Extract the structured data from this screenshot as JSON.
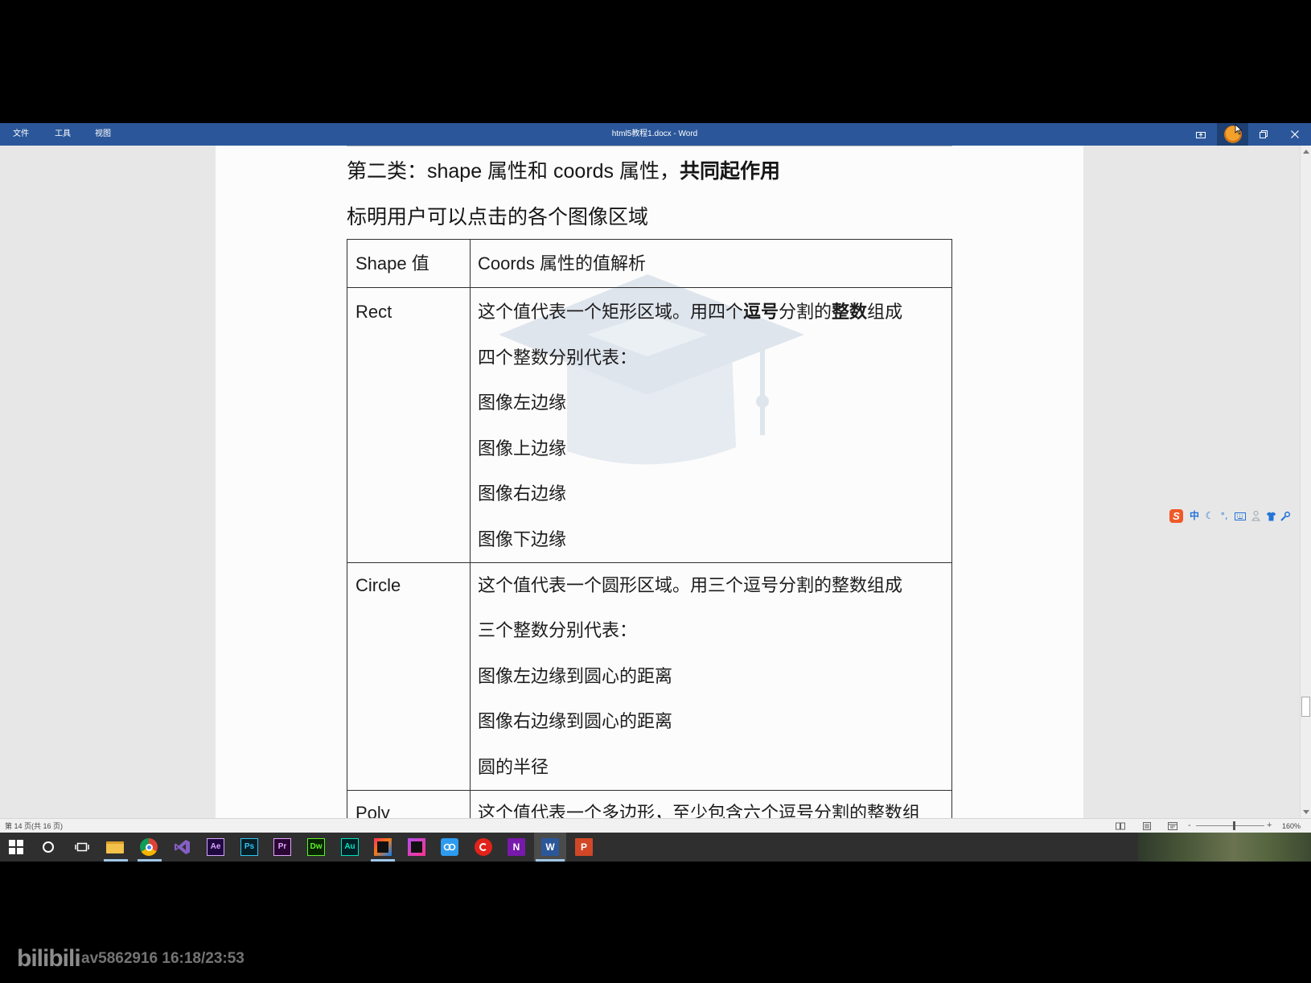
{
  "window": {
    "menu": [
      "文件",
      "工具",
      "视图"
    ],
    "title": "html5教程1.docx - Word",
    "title_bar_color": "#2b579a",
    "controls": [
      "ribbon-display-options-icon",
      "user-avatar-icon",
      "restore-icon",
      "close-icon"
    ]
  },
  "document": {
    "heading": {
      "normal": "第二类：shape 属性和 coords 属性，",
      "bold": "共同起作用"
    },
    "subheading": "标明用户可以点击的各个图像区域",
    "watermark_icon": "graduation-cap-icon",
    "table": {
      "headers": [
        "Shape 值",
        "Coords 属性的值解析"
      ],
      "rows": [
        {
          "shape": "Rect",
          "lines": [
            [
              {
                "text": "这个值代表一个矩形区域。用四个",
                "bold": false
              },
              {
                "text": "逗号",
                "bold": true
              },
              {
                "text": "分割的",
                "bold": false
              },
              {
                "text": "整数",
                "bold": true
              },
              {
                "text": "组成",
                "bold": false
              }
            ],
            [
              {
                "text": "四个整数分别代表：",
                "bold": false
              }
            ],
            [
              {
                "text": "图像左边缘",
                "bold": false
              }
            ],
            [
              {
                "text": "图像上边缘",
                "bold": false
              }
            ],
            [
              {
                "text": "图像右边缘",
                "bold": false
              }
            ],
            [
              {
                "text": "图像下边缘",
                "bold": false
              }
            ]
          ]
        },
        {
          "shape": "Circle",
          "lines": [
            [
              {
                "text": "这个值代表一个圆形区域。用三个逗号分割的整数组成",
                "bold": false
              }
            ],
            [
              {
                "text": "三个整数分别代表：",
                "bold": false
              }
            ],
            [
              {
                "text": "图像左边缘到圆心的距离",
                "bold": false
              }
            ],
            [
              {
                "text": "图像右边缘到圆心的距离",
                "bold": false
              }
            ],
            [
              {
                "text": "圆的半径",
                "bold": false
              }
            ]
          ]
        },
        {
          "shape": "Poly",
          "lines": [
            [
              {
                "text": "这个值代表一个多边形，至少包含六个逗号分割的整数组",
                "bold": false
              }
            ]
          ]
        }
      ]
    }
  },
  "ime_toolbar": {
    "logo": "S",
    "mode_label": "中",
    "icons": [
      "sogou-logo-icon",
      "moon-icon",
      "punctuation-icon",
      "keyboard-icon",
      "person-icon",
      "skin-shirt-icon",
      "wrench-icon"
    ],
    "accent_color": "#2473d8"
  },
  "status_bar": {
    "page_info": "第 14 页(共 16 页)",
    "views": [
      "read-mode-icon",
      "print-layout-icon",
      "web-layout-icon"
    ],
    "zoom_minus": "-",
    "zoom_plus": "+",
    "zoom_level": "160%",
    "zoom_slider_fraction": 0.56
  },
  "taskbar": {
    "items": [
      {
        "icon": "windows-start-icon"
      },
      {
        "icon": "search-icon"
      },
      {
        "icon": "task-view-icon"
      },
      {
        "icon": "file-explorer-icon",
        "running": true
      },
      {
        "icon": "chrome-icon",
        "running": true
      },
      {
        "icon": "visual-studio-icon"
      },
      {
        "icon": "after-effects-icon",
        "label": "Ae",
        "color": "#d7a6ff"
      },
      {
        "icon": "photoshop-icon",
        "label": "Ps",
        "color": "#31c5f0"
      },
      {
        "icon": "premiere-icon",
        "label": "Pr",
        "color": "#e3a3ff"
      },
      {
        "icon": "dreamweaver-icon",
        "label": "Dw",
        "color": "#5ff02a"
      },
      {
        "icon": "audition-icon",
        "label": "Au",
        "color": "#00e4bb"
      },
      {
        "icon": "jetbrains-ide-icon",
        "running": true
      },
      {
        "icon": "jetbrains-ide-2-icon"
      },
      {
        "icon": "cloud-app-icon"
      },
      {
        "icon": "netease-music-icon"
      },
      {
        "icon": "onenote-icon",
        "label": "N",
        "color": "#7719aa"
      },
      {
        "icon": "word-icon",
        "label": "W",
        "color": "#2b579a",
        "active": true,
        "running": true
      },
      {
        "icon": "powerpoint-icon",
        "label": "P",
        "color": "#d24726"
      }
    ]
  },
  "video_overlay": {
    "logo": "bilibili",
    "info": "av5862916 16:18/23:53"
  }
}
